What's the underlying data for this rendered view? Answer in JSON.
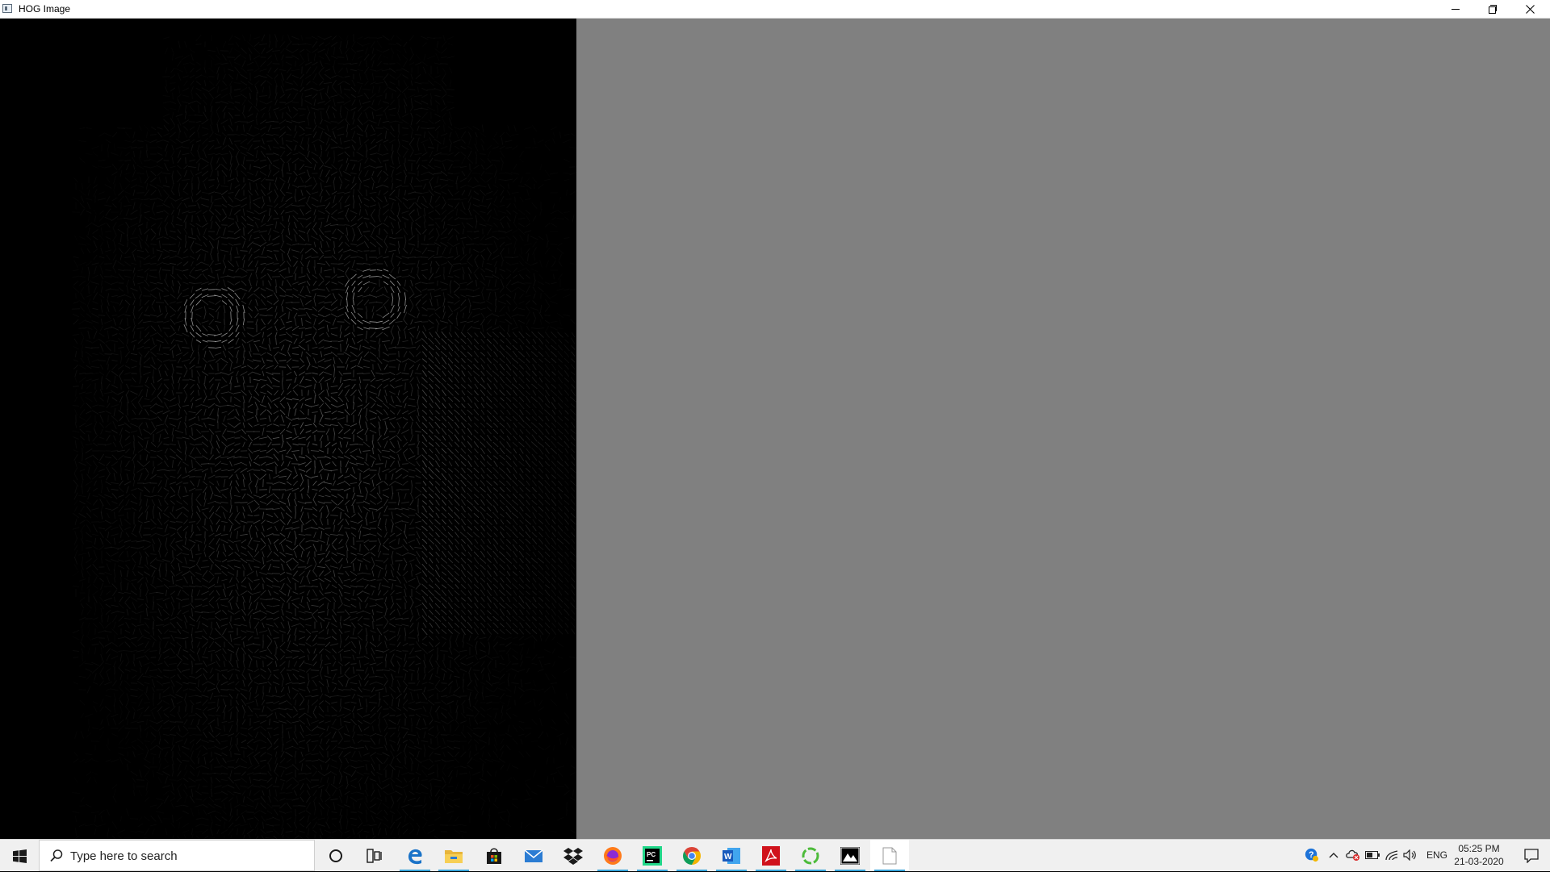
{
  "window": {
    "title": "HOG Image",
    "controls": [
      "minimize",
      "restore",
      "close"
    ]
  },
  "canvas": {
    "description_icon": "hog-visualization",
    "background_color": "#808080",
    "image_background": "#000000"
  },
  "taskbar": {
    "search_placeholder": "Type here to search",
    "apps": [
      {
        "icon": "cortana-icon"
      },
      {
        "icon": "task-view-icon"
      },
      {
        "icon": "edge-icon",
        "running": true
      },
      {
        "icon": "file-explorer-icon",
        "running": true
      },
      {
        "icon": "store-icon"
      },
      {
        "icon": "mail-icon"
      },
      {
        "icon": "dropbox-icon"
      },
      {
        "icon": "firefox-icon",
        "running": true
      },
      {
        "icon": "pycharm-icon",
        "running": true
      },
      {
        "icon": "chrome-icon",
        "running": true
      },
      {
        "icon": "word-icon",
        "running": true
      },
      {
        "icon": "acrobat-icon",
        "running": true
      },
      {
        "icon": "green-circle-app-icon",
        "running": true
      },
      {
        "icon": "photos-icon",
        "running": true
      },
      {
        "icon": "blank-document-icon",
        "running": true,
        "active": true
      }
    ],
    "tray": {
      "language": "ENG",
      "time": "05:25 PM",
      "date": "21-03-2020"
    }
  },
  "colors": {
    "taskbar_bg": "#f0f0f0",
    "accent_underline": "#36a3d9"
  }
}
